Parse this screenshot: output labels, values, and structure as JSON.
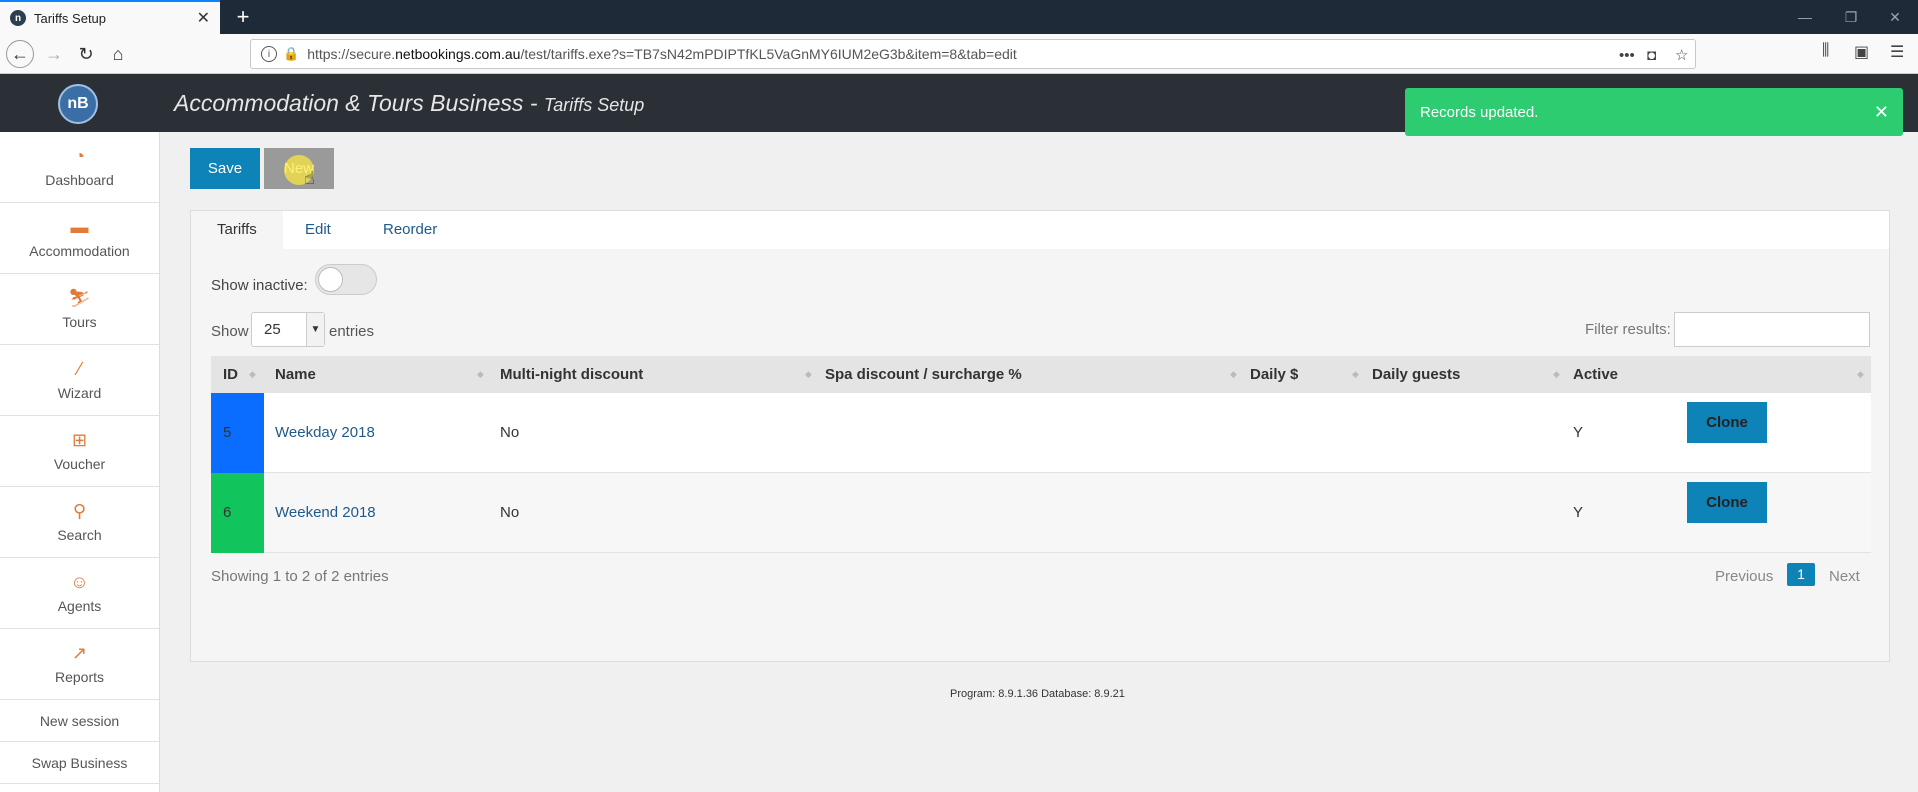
{
  "browser": {
    "tab_title": "Tariffs Setup",
    "favicon_text": "n",
    "url_prefix": "https://secure.",
    "url_domain": "netbookings.com.au",
    "url_path": "/test/tariffs.exe?s=TB7sN42mPDIPTfKL5VaGnMY6IUM2eG3b&item=8&tab=edit"
  },
  "app": {
    "logo_text": "nB",
    "title": "Accommodation & Tours Business - ",
    "subtitle": "Tariffs Setup"
  },
  "toast": {
    "message": "Records updated."
  },
  "sidebar": {
    "items": [
      {
        "label": "Dashboard",
        "icon": "gauge-icon"
      },
      {
        "label": "Accommodation",
        "icon": "bed-icon"
      },
      {
        "label": "Tours",
        "icon": "hiker-icon"
      },
      {
        "label": "Wizard",
        "icon": "wand-icon"
      },
      {
        "label": "Voucher",
        "icon": "gift-icon"
      },
      {
        "label": "Search",
        "icon": "search-icon"
      },
      {
        "label": "Agents",
        "icon": "agent-icon"
      },
      {
        "label": "Reports",
        "icon": "chart-icon"
      },
      {
        "label": "New session"
      },
      {
        "label": "Swap Business"
      }
    ]
  },
  "toolbar": {
    "save_label": "Save",
    "new_label": "New"
  },
  "tabs": [
    {
      "label": "Tariffs"
    },
    {
      "label": "Edit"
    },
    {
      "label": "Reorder"
    }
  ],
  "filters": {
    "show_inactive_label": "Show inactive:",
    "show_label": "Show",
    "entries_value": "25",
    "entries_label": "entries",
    "filter_label": "Filter results:",
    "filter_value": ""
  },
  "table": {
    "columns": [
      "ID",
      "Name",
      "Multi-night discount",
      "Spa discount / surcharge %",
      "Daily $",
      "Daily guests",
      "Active"
    ],
    "rows": [
      {
        "id": "5",
        "name": "Weekday 2018",
        "multi_night": "No",
        "spa": "",
        "daily": "",
        "guests": "",
        "active": "Y",
        "color": "#0a6dff",
        "action": "Clone"
      },
      {
        "id": "6",
        "name": "Weekend 2018",
        "multi_night": "No",
        "spa": "",
        "daily": "",
        "guests": "",
        "active": "Y",
        "color": "#12c45c",
        "action": "Clone"
      }
    ]
  },
  "pagination": {
    "summary": "Showing 1 to 2 of 2 entries",
    "previous": "Previous",
    "current": "1",
    "next": "Next"
  },
  "footer": {
    "version": "Program: 8.9.1.36 Database: 8.9.21"
  }
}
